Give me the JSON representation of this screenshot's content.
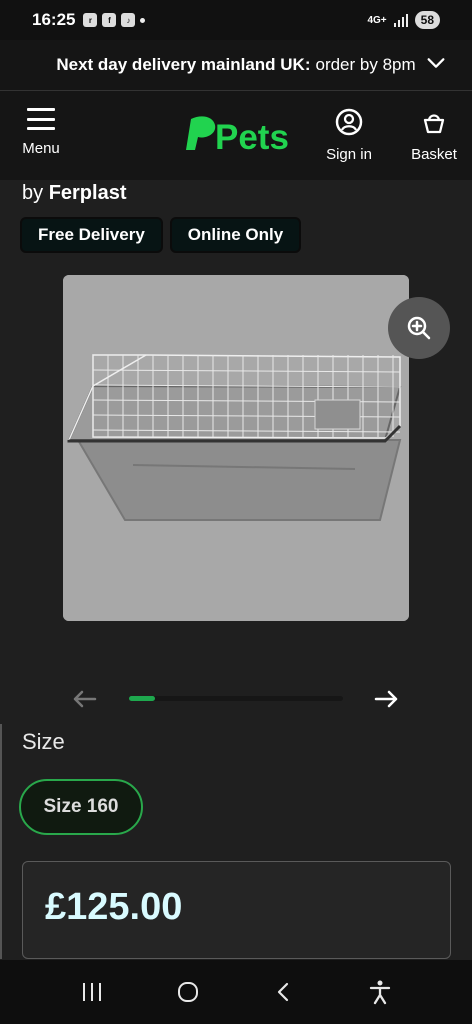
{
  "status": {
    "time": "16:25",
    "network": "4G+",
    "battery": "58",
    "app_icons": [
      "ring-icon",
      "facebook-icon",
      "tiktok-icon"
    ]
  },
  "banner": {
    "strong": "Next day delivery mainland UK:",
    "text": "order by 8pm"
  },
  "header": {
    "menu_label": "Menu",
    "logo_text": "Pets",
    "sign_in_label": "Sign in",
    "basket_label": "Basket"
  },
  "product": {
    "brand_prefix": "by",
    "brand": "Ferplast",
    "badges": [
      "Free Delivery",
      "Online Only"
    ],
    "image_alt": "cage product image",
    "carousel_progress": 0.12
  },
  "size": {
    "title": "Size",
    "selected": "Size 160"
  },
  "price": {
    "value": "£125.00"
  },
  "colors": {
    "accent": "#1ea84e",
    "background": "#1f1f1f",
    "header_background": "#151515",
    "price_color": "#d9fbff"
  },
  "icons": {
    "chevron_down": "chevron-down-icon",
    "menu": "hamburger-icon",
    "account": "account-icon",
    "basket": "basket-icon",
    "zoom": "zoom-in-icon",
    "arrow_left": "arrow-left-icon",
    "arrow_right": "arrow-right-icon",
    "recents": "recent-apps-icon",
    "home": "home-icon",
    "back": "back-icon",
    "accessibility": "accessibility-icon"
  }
}
